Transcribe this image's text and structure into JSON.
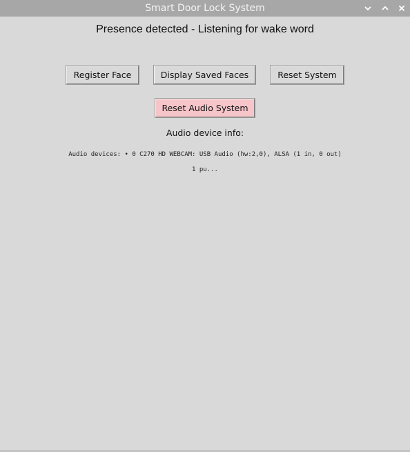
{
  "window": {
    "title": "Smart Door Lock System",
    "controls": {
      "minimize_icon": "chevron-down-icon",
      "maximize_icon": "chevron-up-icon",
      "close_icon": "close-icon"
    },
    "colors": {
      "titlebar": "#a7a7a7",
      "background": "#d9d9d9",
      "audio_reset_button": "#f5c5c9"
    }
  },
  "main": {
    "status": "Presence detected - Listening for wake word",
    "buttons": {
      "register_face": "Register Face",
      "display_saved_faces": "Display Saved Faces",
      "reset_system": "Reset System",
      "reset_audio_system": "Reset Audio System"
    },
    "audio_label": "Audio device info:",
    "audio_info_line1": "Audio devices: • 0 C270 HD WEBCAM: USB Audio (hw:2,0), ALSA (1 in, 0 out)",
    "audio_info_line2": "1 pu..."
  }
}
